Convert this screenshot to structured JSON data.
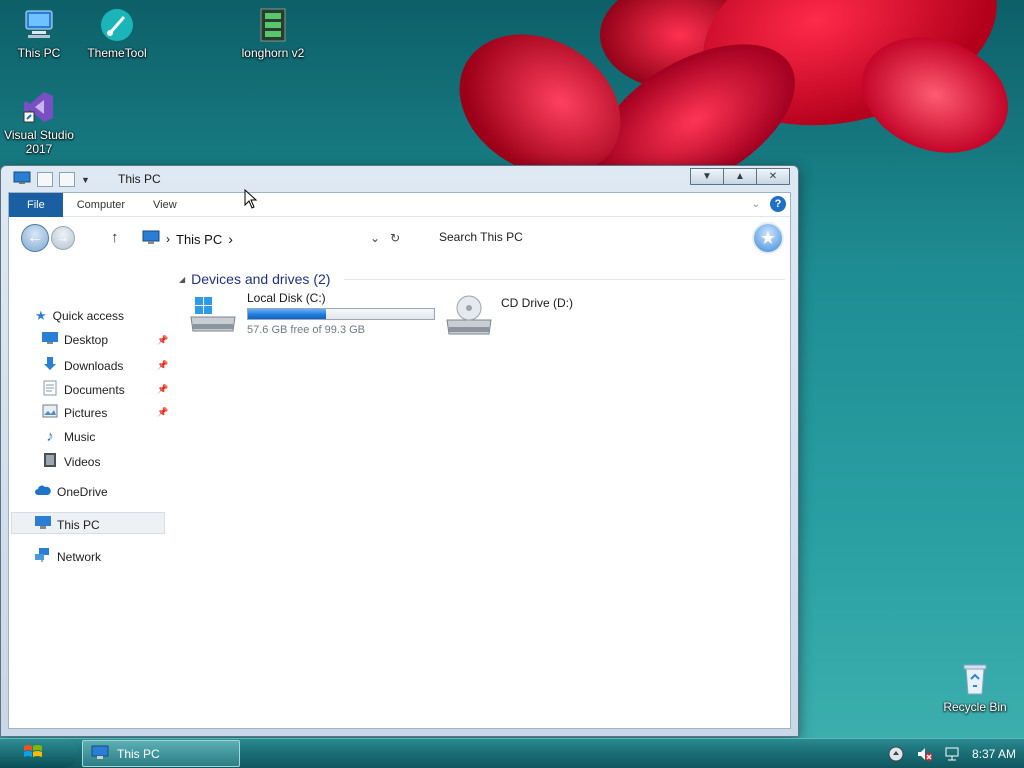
{
  "desktop": {
    "icons": [
      {
        "label": "This PC"
      },
      {
        "label": "ThemeTool"
      },
      {
        "label": "longhorn v2"
      },
      {
        "label": "Visual Studio 2017"
      },
      {
        "label": "Recycle Bin"
      }
    ]
  },
  "window": {
    "title": "This PC",
    "ribbon_tabs": [
      "File",
      "Computer",
      "View"
    ],
    "breadcrumb": "This PC",
    "search_placeholder": "Search This PC"
  },
  "sidebar": {
    "items": [
      {
        "label": "Quick access"
      },
      {
        "label": "Desktop"
      },
      {
        "label": "Downloads"
      },
      {
        "label": "Documents"
      },
      {
        "label": "Pictures"
      },
      {
        "label": "Music"
      },
      {
        "label": "Videos"
      },
      {
        "label": "OneDrive"
      },
      {
        "label": "This PC"
      },
      {
        "label": "Network"
      }
    ]
  },
  "content": {
    "group_title": "Devices and drives (2)",
    "drives": [
      {
        "name": "Local Disk (C:)",
        "free_text": "57.6 GB free of 99.3 GB",
        "used_fraction": 0.42
      },
      {
        "name": "CD Drive (D:)"
      }
    ]
  },
  "taskbar": {
    "task_label": "This PC",
    "clock": "8:37 AM"
  },
  "colors": {
    "accent": "#1b5fa3",
    "usage_bar": "#1d79d8",
    "group_heading": "#1e3287"
  }
}
